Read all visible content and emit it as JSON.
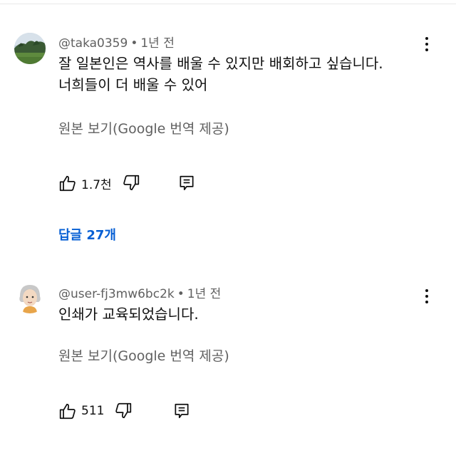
{
  "comments": [
    {
      "author": "@taka0359",
      "separator": "•",
      "time": "1년 전",
      "text_lines": [
        "잘 일본인은 역사를 배울 수 있지만 배회하고 싶습니다.",
        "너희들이 더 배울 수 있어"
      ],
      "translate_label": "원본 보기(Google 번역 제공)",
      "likes": "1.7천",
      "replies_label": "답글 27개",
      "avatar_icon": "landscape-avatar-icon"
    },
    {
      "author": "@user-fj3mw6bc2k",
      "separator": "•",
      "time": "1년 전",
      "text_lines": [
        "인쇄가 교육되었습니다."
      ],
      "translate_label": "원본 보기(Google 번역 제공)",
      "likes": "511",
      "avatar_icon": "cartoon-person-avatar-icon"
    }
  ],
  "icons": {
    "like": "thumbs-up-icon",
    "dislike": "thumbs-down-icon",
    "reply": "reply-comment-icon",
    "more": "more-vertical-icon"
  },
  "colors": {
    "link": "#065fd4",
    "secondary_text": "#606060",
    "primary_text": "#0f0f0f"
  }
}
